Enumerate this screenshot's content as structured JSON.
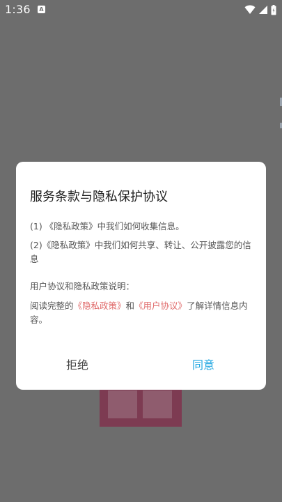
{
  "status_bar": {
    "time": "1:36",
    "notification_badge": "A",
    "icons": [
      "wifi-icon",
      "cellular-signal-icon",
      "battery-icon"
    ]
  },
  "dialog": {
    "title": "服务条款与隐私保护协议",
    "item1": "(1) 《隐私政策》中我们如何收集信息。",
    "item2": "(2)《隐私政策》中我们如何共享、转让、公开披露您的信息",
    "explain_heading": "用户协议和隐私政策说明：",
    "explain_prefix": "阅读完整的",
    "privacy_link": "《隐私政策》",
    "conjunction": "和",
    "user_agreement_link": "《用户协议》",
    "explain_suffix": "了解详情信息内容。",
    "reject_label": "拒绝",
    "agree_label": "同意"
  },
  "colors": {
    "overlay": "#6d6d6d",
    "link": "#e06a6a",
    "accent": "#1aa4e0"
  }
}
